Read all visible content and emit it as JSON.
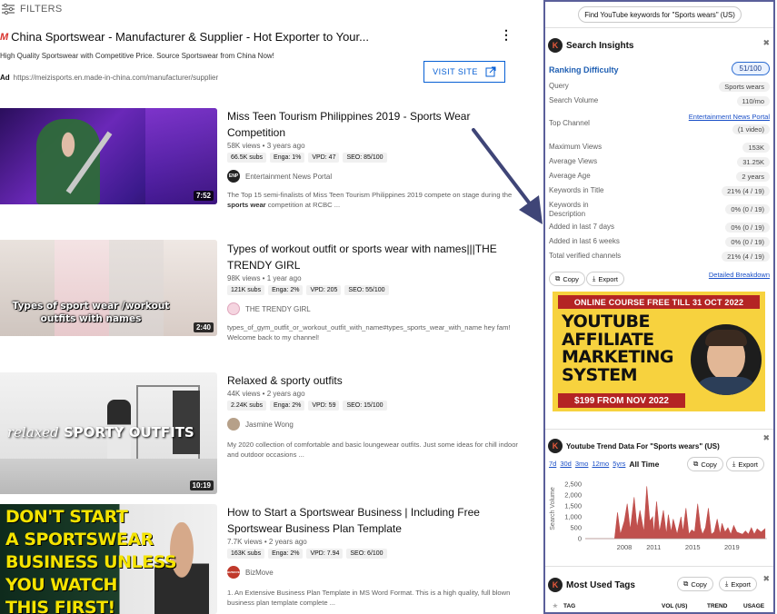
{
  "filters": {
    "label": "FILTERS"
  },
  "ad": {
    "title": "China Sportswear - Manufacturer & Supplier - Hot Exporter to Your...",
    "description": "High Quality Sportswear with Competitive Price. Source Sportswear from China Now!",
    "badge": "Ad",
    "url": "https://meizisports.en.made-in-china.com/manufacturer/supplier",
    "button": "VISIT SITE"
  },
  "videos": [
    {
      "title": "Miss Teen Tourism Philippines 2019 - Sports Wear Competition",
      "meta": "58K views • 3 years ago",
      "badges": [
        "66.5K subs",
        "Enga: 1%",
        "VPD: 47",
        "SEO: 85/100"
      ],
      "channel": "Entertainment News Portal",
      "channel_initials": "ENP",
      "desc_pre": "The Top 15 semi-finalists of Miss Teen Tourism Philippines 2019 compete on stage during the ",
      "desc_bold": "sports wear",
      "desc_post": " competition at RCBC ...",
      "duration": "7:52"
    },
    {
      "title": "Types of workout outfit or sports wear with names|||THE TRENDY GIRL",
      "meta": "98K views • 1 year ago",
      "badges": [
        "121K subs",
        "Enga: 2%",
        "VPD: 205",
        "SEO: 55/100"
      ],
      "channel": "THE TRENDY GIRL",
      "desc": "types_of_gym_outfit_or_workout_outfit_with_name#types_sports_wear_with_name hey fam! Welcome back to my channel!",
      "duration": "2:40",
      "thumb_caption": "Types of sport wear /workout outfits with names"
    },
    {
      "title": "Relaxed & sporty outfits",
      "meta": "44K views • 2 years ago",
      "badges": [
        "2.24K subs",
        "Enga: 2%",
        "VPD: 59",
        "SEO: 15/100"
      ],
      "channel": "Jasmine Wong",
      "desc": "My 2020 collection of comfortable and basic loungewear outfits. Just some ideas for chill indoor and outdoor occasions ...",
      "duration": "10:19",
      "thumb_word1": "relaxed",
      "thumb_word2": "SPORTY OUTFITS"
    },
    {
      "title": "How to Start a Sportswear Business | Including Free Sportswear Business Plan Template",
      "meta": "7.7K views • 2 years ago",
      "badges": [
        "163K subs",
        "Enga: 2%",
        "VPD: 7.94",
        "SEO: 6/100"
      ],
      "channel": "BizMove",
      "channel_initials": "BIZMOVE",
      "desc": "1. An Extensive Business Plan Template in MS Word Format. This is a high quality, full blown business plan template complete ...",
      "thumb_lines": [
        "DON'T START",
        "A SPORTSWEAR",
        "BUSINESS UNLESS",
        "YOU WATCH",
        "THIS FIRST!"
      ]
    }
  ],
  "panel": {
    "find_button": "Find YouTube keywords for \"Sports wears\" (US)",
    "insights": {
      "title": "Search Insights",
      "ranking_label": "Ranking Difficulty",
      "ranking_value": "51/100",
      "rows": [
        {
          "label": "Query",
          "value": "Sports wears"
        },
        {
          "label": "Search Volume",
          "value": "110/mo"
        },
        {
          "label": "Top Channel",
          "value": "(1 video)",
          "link": "Entertainment News Portal"
        },
        {
          "label": "Maximum Views",
          "value": "153K"
        },
        {
          "label": "Average Views",
          "value": "31.25K"
        },
        {
          "label": "Average Age",
          "value": "2 years"
        },
        {
          "label": "Keywords in Title",
          "value": "21% (4 / 19)"
        },
        {
          "label": "Keywords in Description",
          "value": "0% (0 / 19)"
        },
        {
          "label": "Added in last 7 days",
          "value": "0% (0 / 19)"
        },
        {
          "label": "Added in last 6 weeks",
          "value": "0% (0 / 19)"
        },
        {
          "label": "Total verified channels",
          "value": "21% (4 / 19)"
        }
      ],
      "copy": "Copy",
      "export": "Export",
      "breakdown": "Detailed Breakdown"
    },
    "promo": {
      "top": "ONLINE COURSE FREE TILL 31 OCT 2022",
      "lines": [
        "YOUTUBE",
        "AFFILIATE",
        "MARKETING",
        "SYSTEM"
      ],
      "bottom": "$199 FROM NOV 2022"
    },
    "trend": {
      "title": "Youtube Trend Data For \"Sports wears\" (US)",
      "tabs": [
        "7d",
        "30d",
        "3mo",
        "12mo",
        "5yrs"
      ],
      "active_tab": "All Time",
      "copy": "Copy",
      "export": "Export"
    },
    "tags": {
      "title": "Most Used Tags",
      "copy": "Copy",
      "export": "Export",
      "columns": [
        "TAG",
        "VOL (US)",
        "TREND",
        "USAGE"
      ]
    }
  },
  "chart_data": {
    "type": "area",
    "ylabel": "Search Volume",
    "ylim": [
      0,
      2750
    ],
    "yticks": [
      0,
      500,
      1000,
      1500,
      2000,
      2500
    ],
    "yticklabels": [
      "0",
      "500",
      "1,000",
      "1,500",
      "2,000",
      "2,500"
    ],
    "xticks": [
      "2008",
      "2011",
      "2015",
      "2019"
    ],
    "color": "#c0504d",
    "series": [
      {
        "x": [
          2004.0,
          2004.5,
          2005.0,
          2005.5,
          2006.0,
          2006.5,
          2007.0,
          2007.3,
          2007.6,
          2008.0,
          2008.3,
          2008.6,
          2009.0,
          2009.3,
          2009.6,
          2010.0,
          2010.3,
          2010.6,
          2010.9,
          2011.0,
          2011.3,
          2011.6,
          2012.0,
          2012.3,
          2012.5,
          2012.8,
          2013.0,
          2013.4,
          2013.8,
          2014.0,
          2014.3,
          2014.6,
          2014.9,
          2015.2,
          2015.5,
          2015.8,
          2016.0,
          2016.3,
          2016.6,
          2016.9,
          2017.2,
          2017.5,
          2017.8,
          2018.0,
          2018.3,
          2018.6,
          2018.9,
          2019.2,
          2019.5,
          2019.8,
          2020.1,
          2020.4,
          2020.7,
          2021.0,
          2021.3,
          2021.6,
          2022.0,
          2022.4
        ],
        "values": [
          0,
          0,
          0,
          0,
          0,
          0,
          0,
          1200,
          200,
          800,
          1600,
          400,
          1900,
          500,
          1300,
          300,
          2400,
          800,
          1000,
          200,
          1700,
          300,
          1300,
          200,
          1100,
          300,
          900,
          200,
          1000,
          300,
          1400,
          200,
          400,
          300,
          1600,
          500,
          200,
          500,
          1400,
          200,
          300,
          900,
          200,
          700,
          300,
          500,
          200,
          600,
          300,
          250,
          200,
          350,
          200,
          500,
          200,
          450,
          300,
          450
        ]
      }
    ]
  },
  "colors": {
    "panel_border": "#5a5f9a",
    "link": "#1a4fc7",
    "promo_bg": "#f7d23e",
    "promo_red": "#b42424",
    "yt_blue": "#065fd4"
  }
}
